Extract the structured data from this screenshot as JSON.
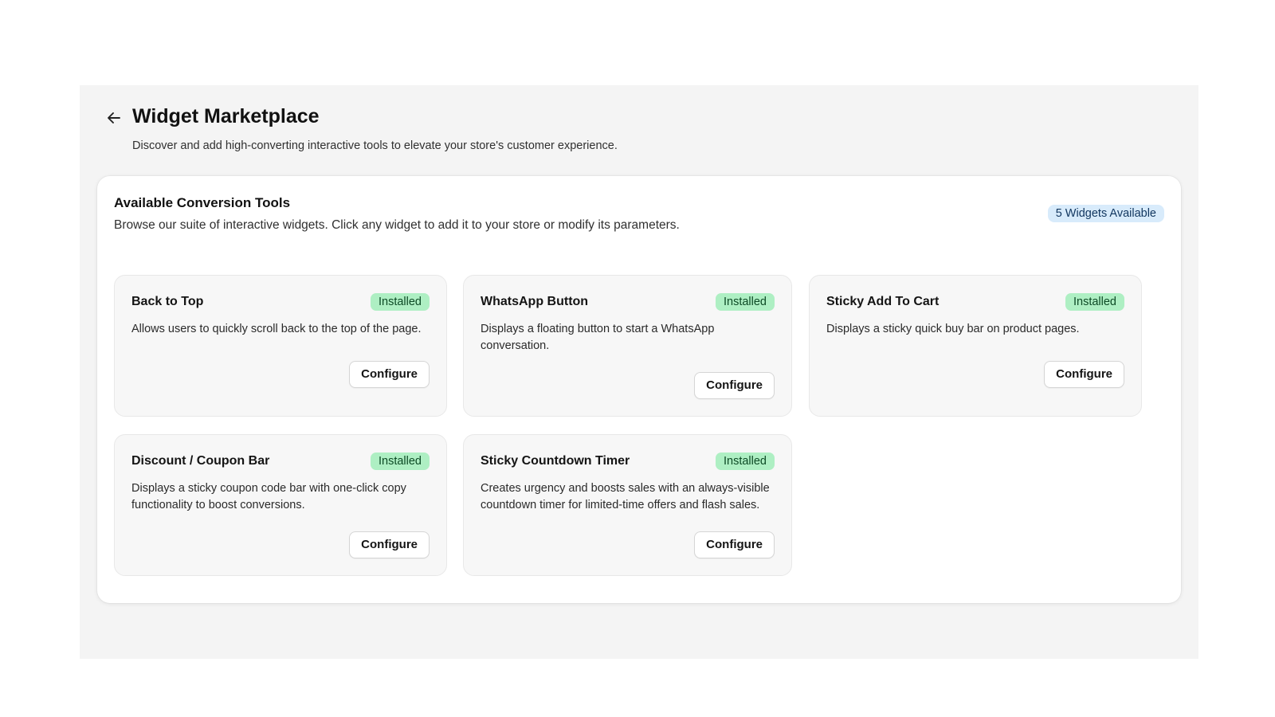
{
  "header": {
    "back_label": "Back",
    "title": "Widget Marketplace",
    "subtitle": "Discover and add high-converting interactive tools to elevate your store's customer experience."
  },
  "panel": {
    "title": "Available Conversion Tools",
    "description": "Browse our suite of interactive widgets. Click any widget to add it to your store or modify its parameters.",
    "count_badge": "5 Widgets Available"
  },
  "widgets": [
    {
      "title": "Back to Top",
      "status": "Installed",
      "description": "Allows users to quickly scroll back to the top of the page.",
      "action_label": "Configure"
    },
    {
      "title": "WhatsApp Button",
      "status": "Installed",
      "description": "Displays a floating button to start a WhatsApp conversation.",
      "action_label": "Configure"
    },
    {
      "title": "Sticky Add To Cart",
      "status": "Installed",
      "description": "Displays a sticky quick buy bar on product pages.",
      "action_label": "Configure"
    },
    {
      "title": "Discount / Coupon Bar",
      "status": "Installed",
      "description": "Displays a sticky coupon code bar with one-click copy functionality to boost conversions.",
      "action_label": "Configure"
    },
    {
      "title": "Sticky Countdown Timer",
      "status": "Installed",
      "description": "Creates urgency and boosts sales with an always-visible countdown timer for limited-time offers and flash sales.",
      "action_label": "Configure"
    }
  ],
  "icons": {
    "back": "arrow-left-icon"
  },
  "colors": {
    "installed_badge_bg": "#aeefc3",
    "count_badge_bg": "#d8ebfb"
  }
}
